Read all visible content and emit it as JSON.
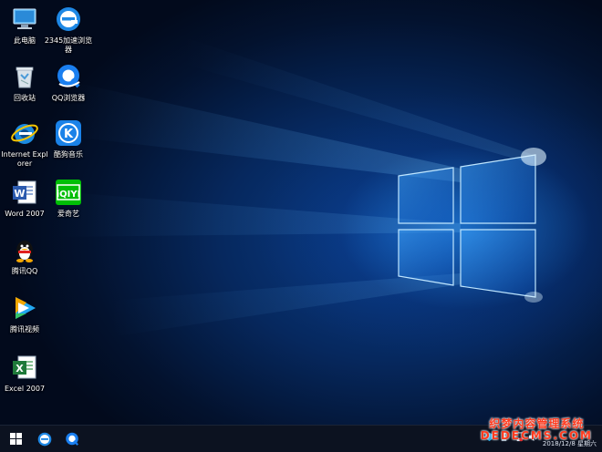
{
  "desktop": {
    "icons": [
      {
        "label": "此电脑",
        "icon": "computer-icon"
      },
      {
        "label": "2345加速浏览器",
        "icon": "browser-2345-icon"
      },
      {
        "label": "回收站",
        "icon": "recycle-bin-icon"
      },
      {
        "label": "QQ浏览器",
        "icon": "qq-browser-icon"
      },
      {
        "label": "Internet Explorer",
        "icon": "internet-explorer-icon"
      },
      {
        "label": "酷狗音乐",
        "icon": "kugou-music-icon"
      },
      {
        "label": "Word 2007",
        "icon": "word-icon"
      },
      {
        "label": "爱奇艺",
        "icon": "iqiyi-icon"
      },
      {
        "label": "腾讯QQ",
        "icon": "qq-penguin-icon"
      },
      {
        "label": "腾讯视频",
        "icon": "tencent-video-icon"
      },
      {
        "label": "Excel 2007",
        "icon": "excel-icon"
      }
    ]
  },
  "taskbar": {
    "clock_date": "2018/12/8 星期六"
  },
  "watermark": {
    "line1": "织梦内容管理系统",
    "line2": "DEDECMS.COM"
  },
  "colors": {
    "accent_blue": "#1e90ff",
    "taskbar_bg": "#0c1220",
    "watermark_red": "#ff3b1f"
  }
}
